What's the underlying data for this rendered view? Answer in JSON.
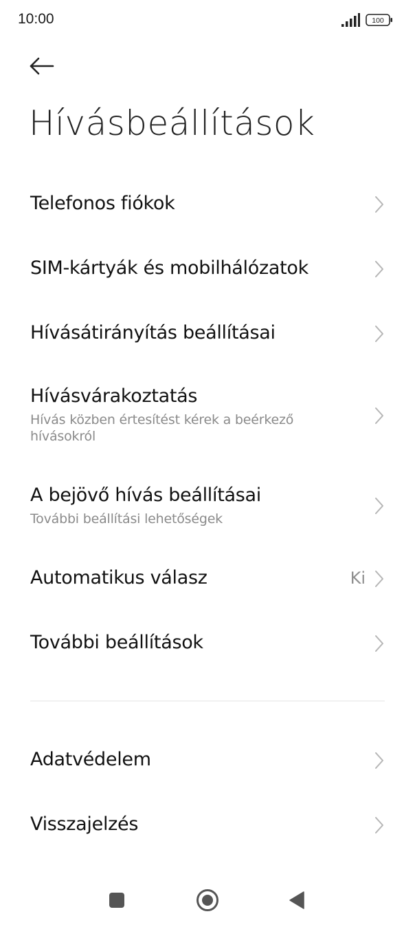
{
  "status_bar": {
    "time": "10:00",
    "battery_level": "100",
    "signal_icon": "signal-bars-icon",
    "battery_icon": "battery-icon"
  },
  "header": {
    "back_icon": "arrow-left-icon",
    "title": "Hívásbeállítások"
  },
  "settings": [
    {
      "title": "Telefonos fiókok",
      "subtitle": "",
      "value": ""
    },
    {
      "title": "SIM-kártyák és mobilhálózatok",
      "subtitle": "",
      "value": ""
    },
    {
      "title": "Hívásátirányítás beállításai",
      "subtitle": "",
      "value": ""
    },
    {
      "title": "Hívásvárakoztatás",
      "subtitle": "Hívás közben értesítést kérek a beérkező hívásokról",
      "value": ""
    },
    {
      "title": "A bejövő hívás beállításai",
      "subtitle": "További beállítási lehetőségek",
      "value": ""
    },
    {
      "title": "Automatikus válasz",
      "subtitle": "",
      "value": "Ki"
    },
    {
      "title": "További beállítások",
      "subtitle": "",
      "value": ""
    }
  ],
  "settings_secondary": [
    {
      "title": "Adatvédelem"
    },
    {
      "title": "Visszajelzés"
    }
  ],
  "nav_bar": {
    "recents_icon": "square-recents-icon",
    "home_icon": "circle-home-icon",
    "back_icon": "triangle-back-icon"
  },
  "colors": {
    "background": "#ffffff",
    "text_primary": "#111111",
    "text_secondary": "#8a8a8a",
    "chevron": "#b5b5b5",
    "divider": "#e4e4e4",
    "nav_icons": "#555555"
  }
}
